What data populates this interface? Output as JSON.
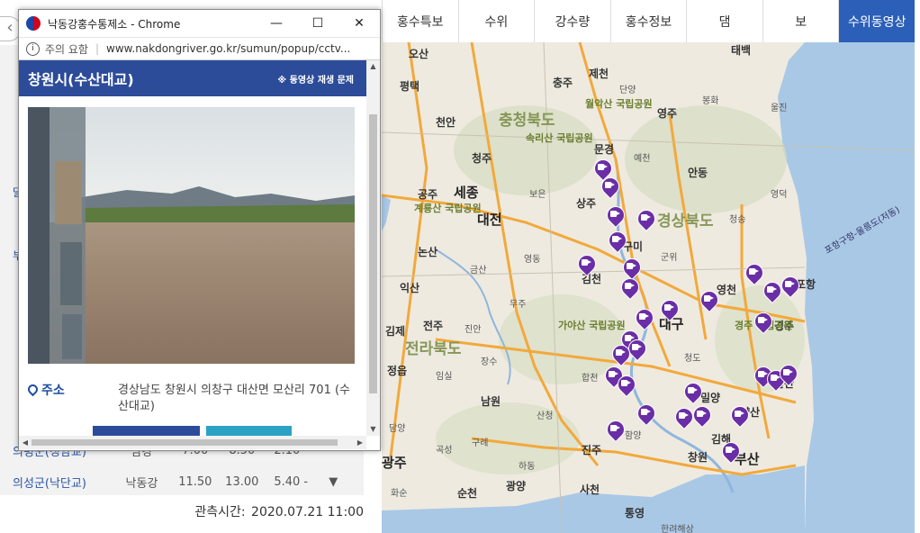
{
  "popup": {
    "window_title": "낙동강홍수통제소 - Chrome",
    "security_label": "주의 요함",
    "url": "www.nakdongriver.go.kr/sumun/popup/cctv...",
    "station_name": "창원시(수산대교)",
    "playback_issue_link": "※ 동영상 재생 문제",
    "address_label": "주소",
    "address_value": "경상남도 창원시 의창구 대산면 모산리 701 (수산대교)"
  },
  "nav": {
    "tabs": [
      "홍수특보",
      "수위",
      "강수량",
      "홍수정보",
      "댐",
      "보",
      "수위동영상"
    ],
    "active_index": 6
  },
  "background_table": {
    "partial_row": {
      "name": "의령군(정암교)",
      "river": "남강",
      "v1": "7.00",
      "v2": "8.50",
      "v3": "2.10 -",
      "trend": "-"
    },
    "row": {
      "name": "의성군(낙단교)",
      "river": "낙동강",
      "v1": "11.50",
      "v2": "13.00",
      "v3": "5.40 -",
      "trend": "▼"
    },
    "side_letters": [
      "달",
      "부"
    ],
    "observed_label": "관측시간:",
    "observed_time": "2020.07.21 11:00"
  },
  "map": {
    "cities": [
      "오산",
      "제천",
      "태백",
      "평택",
      "충주",
      "단양",
      "봉화",
      "천안",
      "충청북도",
      "월악산 국립공원",
      "영주",
      "울진",
      "속리산 국립공원",
      "문경",
      "예천",
      "청주",
      "안동",
      "공주",
      "세종",
      "보은",
      "영덕",
      "계룡산 국립공원",
      "대전",
      "상주",
      "경상북도",
      "청송",
      "논산",
      "구미",
      "금산",
      "영동",
      "군위",
      "익산",
      "김천",
      "영천",
      "포항",
      "무주",
      "대구",
      "경주",
      "김제",
      "전주",
      "진안",
      "전라북도",
      "가야산 국립공원",
      "경주 국립공원",
      "정읍",
      "임실",
      "장수",
      "합천",
      "청도",
      "밀양",
      "울산",
      "남원",
      "산청",
      "양산",
      "담양",
      "함양",
      "김해",
      "광주",
      "곡성",
      "구례",
      "진주",
      "창원",
      "부산",
      "하동",
      "광양",
      "순천",
      "사천",
      "통영",
      "화순",
      "한려해상"
    ],
    "highway_numbers": [
      "35",
      "45",
      "55",
      "25",
      "30",
      "1",
      "20",
      "27",
      "12",
      "35",
      "10"
    ],
    "sea_labels": [
      "포항구항-울릉도(저동)",
      "포항"
    ]
  },
  "colors": {
    "accent": "#2c5fb7",
    "popup_header": "#2c4c9a",
    "pin": "#6a2ea6",
    "map_land": "#eeeae0",
    "map_sea": "#a9c8e6"
  }
}
